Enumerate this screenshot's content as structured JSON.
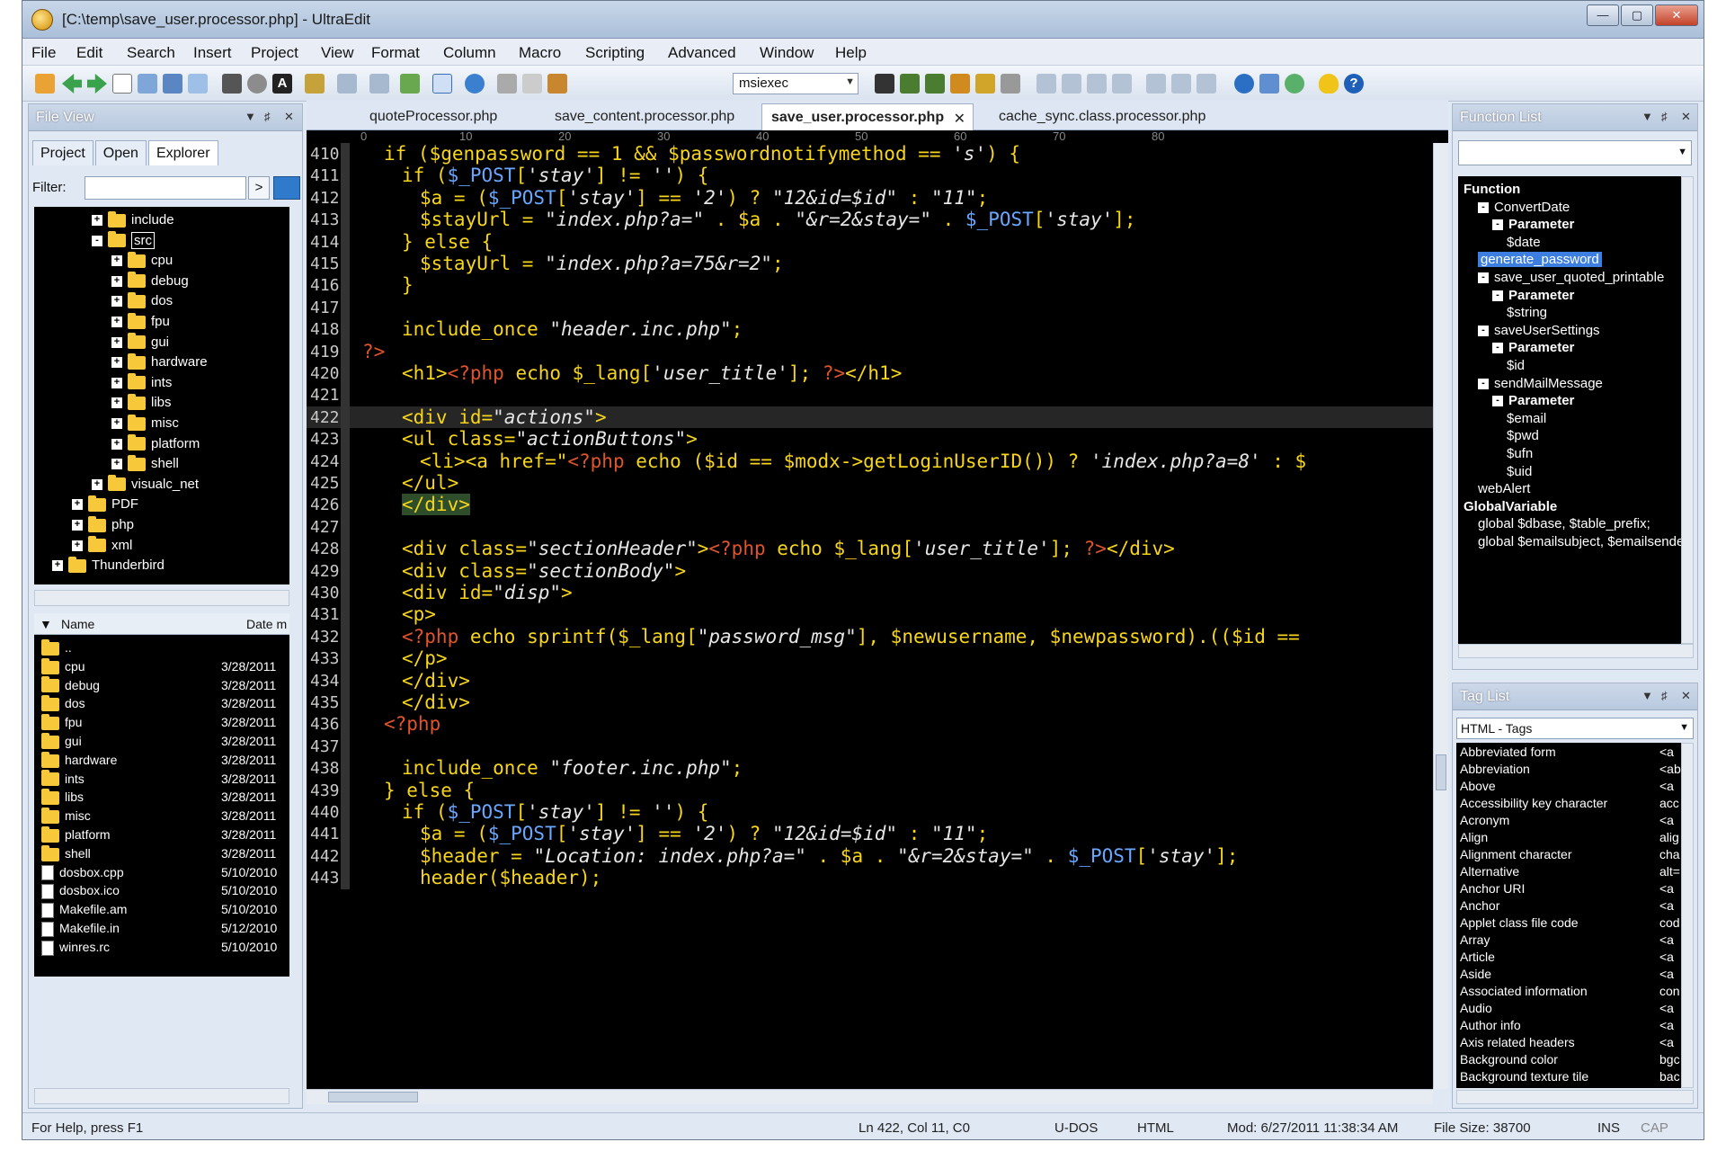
{
  "window": {
    "title": "[C:\\temp\\save_user.processor.php] - UltraEdit"
  },
  "menu": [
    "File",
    "Edit",
    "Search",
    "Insert",
    "Project",
    "View",
    "Format",
    "Column",
    "Macro",
    "Scripting",
    "Advanced",
    "Window",
    "Help"
  ],
  "toolbar": {
    "combo_value": "msiexec"
  },
  "file_view": {
    "title": "File View",
    "tabs": [
      "Project",
      "Open",
      "Explorer"
    ],
    "filter_label": "Filter:",
    "tree": [
      {
        "label": "include",
        "depth": 4,
        "exp": "+"
      },
      {
        "label": "src",
        "depth": 4,
        "exp": "-",
        "selected": true
      },
      {
        "label": "cpu",
        "depth": 5,
        "exp": "+"
      },
      {
        "label": "debug",
        "depth": 5,
        "exp": "+"
      },
      {
        "label": "dos",
        "depth": 5,
        "exp": "+"
      },
      {
        "label": "fpu",
        "depth": 5,
        "exp": "+"
      },
      {
        "label": "gui",
        "depth": 5,
        "exp": "+"
      },
      {
        "label": "hardware",
        "depth": 5,
        "exp": "+"
      },
      {
        "label": "ints",
        "depth": 5,
        "exp": "+"
      },
      {
        "label": "libs",
        "depth": 5,
        "exp": "+"
      },
      {
        "label": "misc",
        "depth": 5,
        "exp": "+"
      },
      {
        "label": "platform",
        "depth": 5,
        "exp": "+"
      },
      {
        "label": "shell",
        "depth": 5,
        "exp": "+"
      },
      {
        "label": "visualc_net",
        "depth": 4,
        "exp": "+"
      },
      {
        "label": "PDF",
        "depth": 3,
        "exp": "+"
      },
      {
        "label": "php",
        "depth": 3,
        "exp": "+"
      },
      {
        "label": "xml",
        "depth": 3,
        "exp": "+"
      },
      {
        "label": "Thunderbird",
        "depth": 2,
        "exp": "+"
      }
    ],
    "list_headers": [
      "Name",
      "Date m"
    ],
    "files": [
      {
        "name": "..",
        "date": "",
        "type": "folder"
      },
      {
        "name": "cpu",
        "date": "3/28/2011",
        "type": "folder"
      },
      {
        "name": "debug",
        "date": "3/28/2011",
        "type": "folder"
      },
      {
        "name": "dos",
        "date": "3/28/2011",
        "type": "folder"
      },
      {
        "name": "fpu",
        "date": "3/28/2011",
        "type": "folder"
      },
      {
        "name": "gui",
        "date": "3/28/2011",
        "type": "folder"
      },
      {
        "name": "hardware",
        "date": "3/28/2011",
        "type": "folder"
      },
      {
        "name": "ints",
        "date": "3/28/2011",
        "type": "folder"
      },
      {
        "name": "libs",
        "date": "3/28/2011",
        "type": "folder"
      },
      {
        "name": "misc",
        "date": "3/28/2011",
        "type": "folder"
      },
      {
        "name": "platform",
        "date": "3/28/2011",
        "type": "folder"
      },
      {
        "name": "shell",
        "date": "3/28/2011",
        "type": "folder"
      },
      {
        "name": "dosbox.cpp",
        "date": "5/10/2010",
        "type": "file"
      },
      {
        "name": "dosbox.ico",
        "date": "5/10/2010",
        "type": "file"
      },
      {
        "name": "Makefile.am",
        "date": "5/10/2010",
        "type": "file"
      },
      {
        "name": "Makefile.in",
        "date": "5/12/2010",
        "type": "file"
      },
      {
        "name": "winres.rc",
        "date": "5/10/2010",
        "type": "file"
      }
    ]
  },
  "editor": {
    "tabs": [
      "quoteProcessor.php",
      "save_content.processor.php",
      "save_user.processor.php",
      "cache_sync.class.processor.php"
    ],
    "active_tab": 2,
    "ruler": [
      "0",
      "10",
      "20",
      "30",
      "40",
      "50",
      "60",
      "70",
      "80"
    ],
    "lines": [
      {
        "n": "410",
        "t": "if ($genpassword == 1 && $passwordnotifymethod == 's') {"
      },
      {
        "n": "411",
        "t": "if ($_POST['stay'] != '') {"
      },
      {
        "n": "412",
        "t": "$a = ($_POST['stay'] == '2') ? \"12&id=$id\" : \"11\";"
      },
      {
        "n": "413",
        "t": "$stayUrl = \"index.php?a=\" . $a . \"&r=2&stay=\" . $_POST['stay'];"
      },
      {
        "n": "414",
        "t": "} else {"
      },
      {
        "n": "415",
        "t": "$stayUrl = \"index.php?a=75&r=2\";"
      },
      {
        "n": "416",
        "t": "}"
      },
      {
        "n": "417",
        "t": ""
      },
      {
        "n": "418",
        "t": "include_once \"header.inc.php\";"
      },
      {
        "n": "419",
        "t": "?>"
      },
      {
        "n": "420",
        "t": "<h1><?php echo $_lang['user_title']; ?></h1>"
      },
      {
        "n": "421",
        "t": ""
      },
      {
        "n": "422",
        "t": "<div id=\"actions\">"
      },
      {
        "n": "423",
        "t": "<ul class=\"actionButtons\">"
      },
      {
        "n": "424",
        "t": "<li><a href=\"<?php echo ($id == $modx->getLoginUserID()) ? 'index.php?a=8' : $"
      },
      {
        "n": "425",
        "t": "</ul>"
      },
      {
        "n": "426",
        "t": "</div>"
      },
      {
        "n": "427",
        "t": ""
      },
      {
        "n": "428",
        "t": "<div class=\"sectionHeader\"><?php echo $_lang['user_title']; ?></div>"
      },
      {
        "n": "429",
        "t": "<div class=\"sectionBody\">"
      },
      {
        "n": "430",
        "t": "<div id=\"disp\">"
      },
      {
        "n": "431",
        "t": "<p>"
      },
      {
        "n": "432",
        "t": "<?php echo sprintf($_lang[\"password_msg\"], $newusername, $newpassword).(($id =="
      },
      {
        "n": "433",
        "t": "</p>"
      },
      {
        "n": "434",
        "t": "</div>"
      },
      {
        "n": "435",
        "t": "</div>"
      },
      {
        "n": "436",
        "t": "<?php"
      },
      {
        "n": "437",
        "t": ""
      },
      {
        "n": "438",
        "t": "include_once \"footer.inc.php\";"
      },
      {
        "n": "439",
        "t": "} else {"
      },
      {
        "n": "440",
        "t": "if ($_POST['stay'] != '') {"
      },
      {
        "n": "441",
        "t": "$a = ($_POST['stay'] == '2') ? \"12&id=$id\" : \"11\";"
      },
      {
        "n": "442",
        "t": "$header = \"Location: index.php?a=\" . $a . \"&r=2&stay=\" . $_POST['stay'];"
      },
      {
        "n": "443",
        "t": "header($header);"
      }
    ]
  },
  "function_list": {
    "title": "Function List",
    "items": [
      {
        "label": "Function",
        "bold": true,
        "depth": 0
      },
      {
        "label": "ConvertDate",
        "depth": 1,
        "exp": "-"
      },
      {
        "label": "Parameter",
        "depth": 2,
        "bold": true,
        "exp": "-"
      },
      {
        "label": "$date",
        "depth": 3
      },
      {
        "label": "generate_password",
        "depth": 1,
        "selected": true
      },
      {
        "label": "save_user_quoted_printable",
        "depth": 1,
        "exp": "-"
      },
      {
        "label": "Parameter",
        "depth": 2,
        "bold": true,
        "exp": "-"
      },
      {
        "label": "$string",
        "depth": 3
      },
      {
        "label": "saveUserSettings",
        "depth": 1,
        "exp": "-"
      },
      {
        "label": "Parameter",
        "depth": 2,
        "bold": true,
        "exp": "-"
      },
      {
        "label": "$id",
        "depth": 3
      },
      {
        "label": "sendMailMessage",
        "depth": 1,
        "exp": "-"
      },
      {
        "label": "Parameter",
        "depth": 2,
        "bold": true,
        "exp": "-"
      },
      {
        "label": "$email",
        "depth": 3
      },
      {
        "label": "$pwd",
        "depth": 3
      },
      {
        "label": "$ufn",
        "depth": 3
      },
      {
        "label": "$uid",
        "depth": 3
      },
      {
        "label": "webAlert",
        "depth": 1
      },
      {
        "label": "GlobalVariable",
        "bold": true,
        "depth": 0
      },
      {
        "label": "global $dbase, $table_prefix;",
        "depth": 1
      },
      {
        "label": "global $emailsubject, $emailsender",
        "depth": 1
      }
    ]
  },
  "tag_list": {
    "title": "Tag List",
    "combo": "HTML - Tags",
    "items": [
      {
        "label": "Abbreviated form",
        "abbr": "<a"
      },
      {
        "label": "Abbreviation",
        "abbr": "<abb"
      },
      {
        "label": "Above",
        "abbr": "<a"
      },
      {
        "label": "Accessibility key character",
        "abbr": "acc"
      },
      {
        "label": "Acronym",
        "abbr": "<a"
      },
      {
        "label": "Align",
        "abbr": "alig"
      },
      {
        "label": "Alignment character",
        "abbr": "cha"
      },
      {
        "label": "Alternative",
        "abbr": "alt="
      },
      {
        "label": "Anchor URI",
        "abbr": "<a"
      },
      {
        "label": "Anchor",
        "abbr": "<a"
      },
      {
        "label": "Applet class file code",
        "abbr": "cod"
      },
      {
        "label": "Array",
        "abbr": "<a"
      },
      {
        "label": "Article",
        "abbr": "<a"
      },
      {
        "label": "Aside",
        "abbr": "<a"
      },
      {
        "label": "Associated information",
        "abbr": "con"
      },
      {
        "label": "Audio",
        "abbr": "<a"
      },
      {
        "label": "Author info",
        "abbr": "<a"
      },
      {
        "label": "Axis related headers",
        "abbr": "<a"
      },
      {
        "label": "Background color",
        "abbr": "bgc"
      },
      {
        "label": "Background texture tile",
        "abbr": "bac"
      }
    ]
  },
  "status": {
    "help": "For Help, press F1",
    "pos": "Ln 422, Col 11, C0",
    "encoding": "U-DOS",
    "lang": "HTML",
    "mod": "Mod: 6/27/2011 11:38:34 AM",
    "size": "File Size: 38700",
    "ins": "INS",
    "cap": "CAP"
  }
}
